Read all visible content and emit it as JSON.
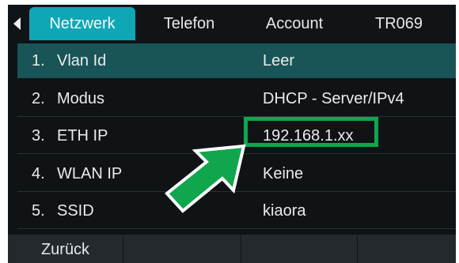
{
  "tabs": [
    {
      "label": "Netzwerk",
      "active": true
    },
    {
      "label": "Telefon",
      "active": false
    },
    {
      "label": "Account",
      "active": false
    },
    {
      "label": "TR069",
      "active": false
    }
  ],
  "rows": [
    {
      "num": "1.",
      "label": "Vlan Id",
      "value": "Leer",
      "selected": true
    },
    {
      "num": "2.",
      "label": "Modus",
      "value": "DHCP - Server/IPv4",
      "selected": false
    },
    {
      "num": "3.",
      "label": "ETH IP",
      "value": "192.168.1.xx",
      "selected": false
    },
    {
      "num": "4.",
      "label": "WLAN IP",
      "value": "Keine",
      "selected": false
    },
    {
      "num": "5.",
      "label": "SSID",
      "value": "kiaora",
      "selected": false
    }
  ],
  "softkeys": [
    "Zurück",
    "",
    "",
    ""
  ],
  "colors": {
    "accent": "#0fa7b6",
    "selected_row": "#195457",
    "highlight": "#0fa64e",
    "background": "#0f1316"
  },
  "icons": {
    "back": "chevron-left-icon",
    "pointer": "arrow-icon"
  }
}
